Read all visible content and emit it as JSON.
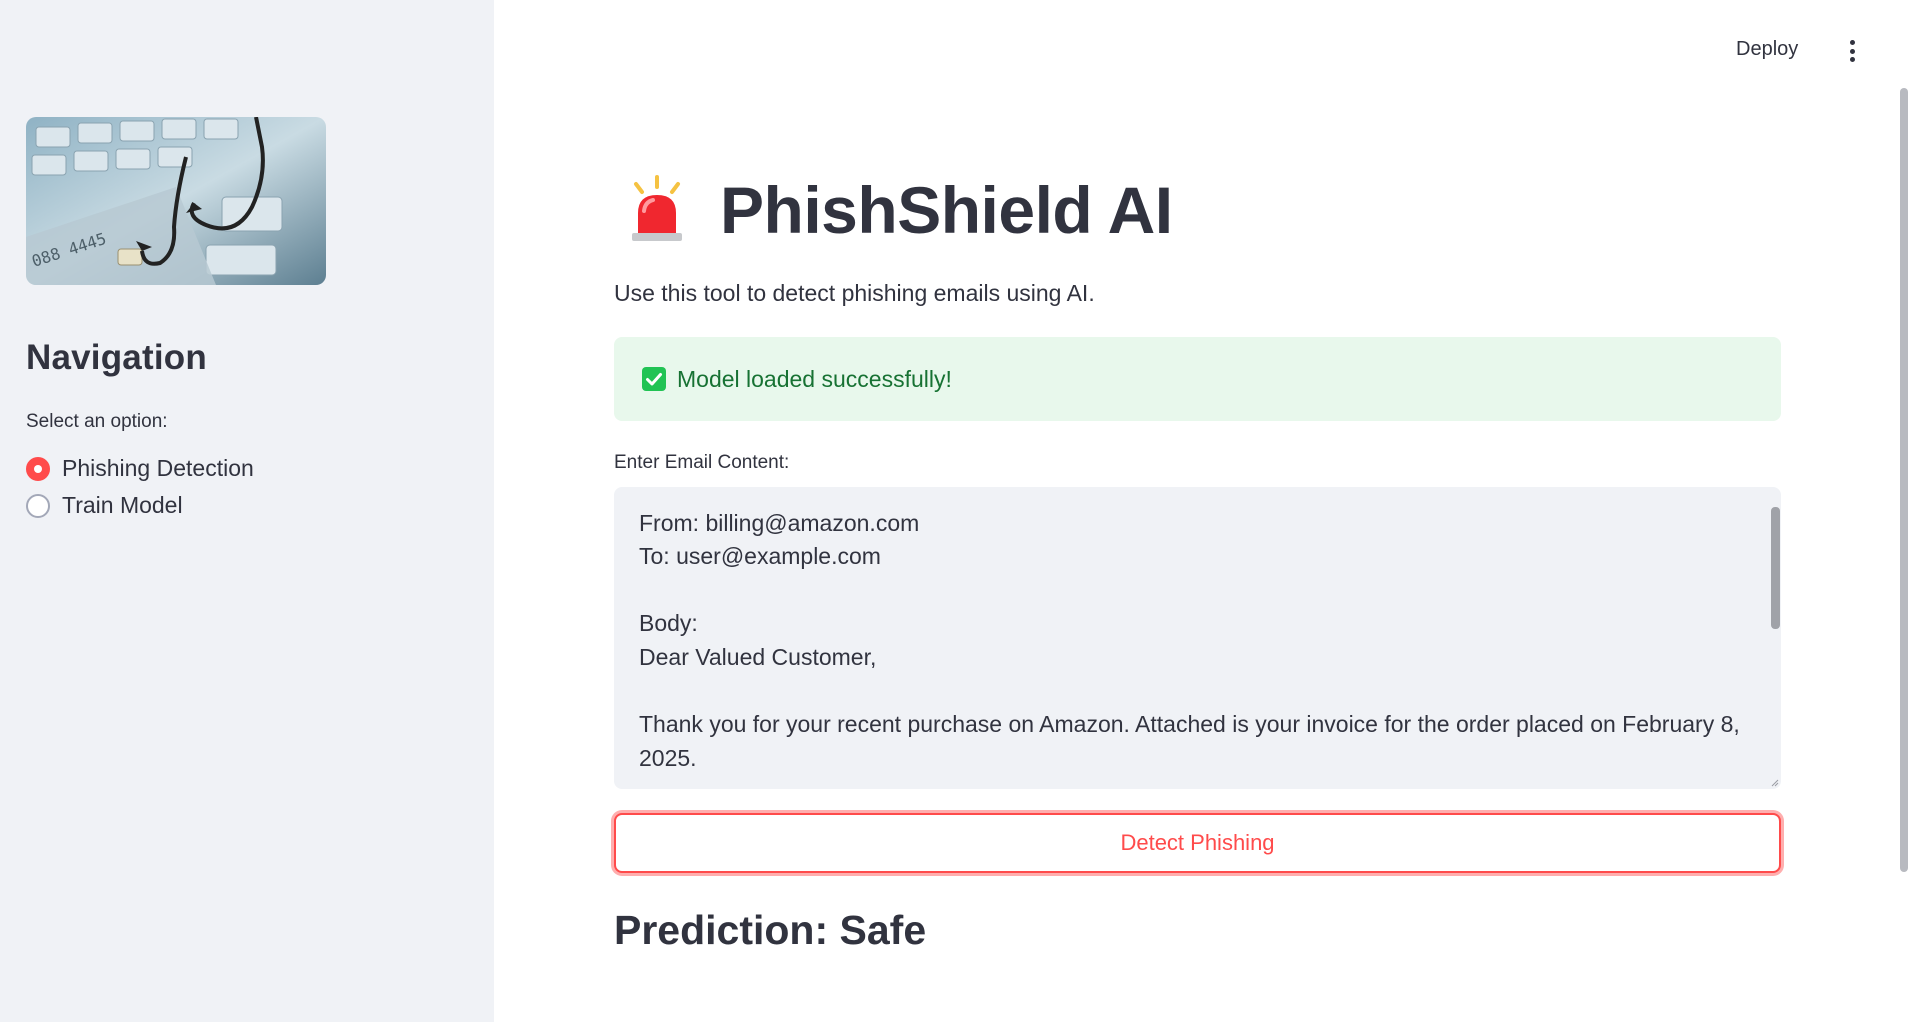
{
  "header": {
    "deploy_label": "Deploy",
    "menu_icon": "kebab-menu-icon"
  },
  "sidebar": {
    "image_alt_icon": "phishing-hook-keyboard-image",
    "nav_title": "Navigation",
    "select_label": "Select an option:",
    "options": [
      {
        "label": "Phishing Detection",
        "selected": true
      },
      {
        "label": "Train Model",
        "selected": false
      }
    ]
  },
  "main": {
    "title_icon": "police-siren-icon",
    "title": "PhishShield AI",
    "subtitle": "Use this tool to detect phishing emails using AI.",
    "success_message": "Model loaded successfully!",
    "success_icon": "check-box-icon",
    "email_label": "Enter Email Content:",
    "email_content": "\nFrom: billing@amazon.com\nTo: user@example.com\n\nBody:\nDear Valued Customer,\n\nThank you for your recent purchase on Amazon. Attached is your invoice for the order placed on February 8, 2025.",
    "detect_button": "Detect Phishing",
    "prediction": "Prediction: Safe"
  },
  "colors": {
    "primary": "#FF4B4B",
    "sidebar_bg": "#F0F2F6",
    "success_bg": "#E8F8EC",
    "success_text": "#177233",
    "text": "#31333F"
  }
}
